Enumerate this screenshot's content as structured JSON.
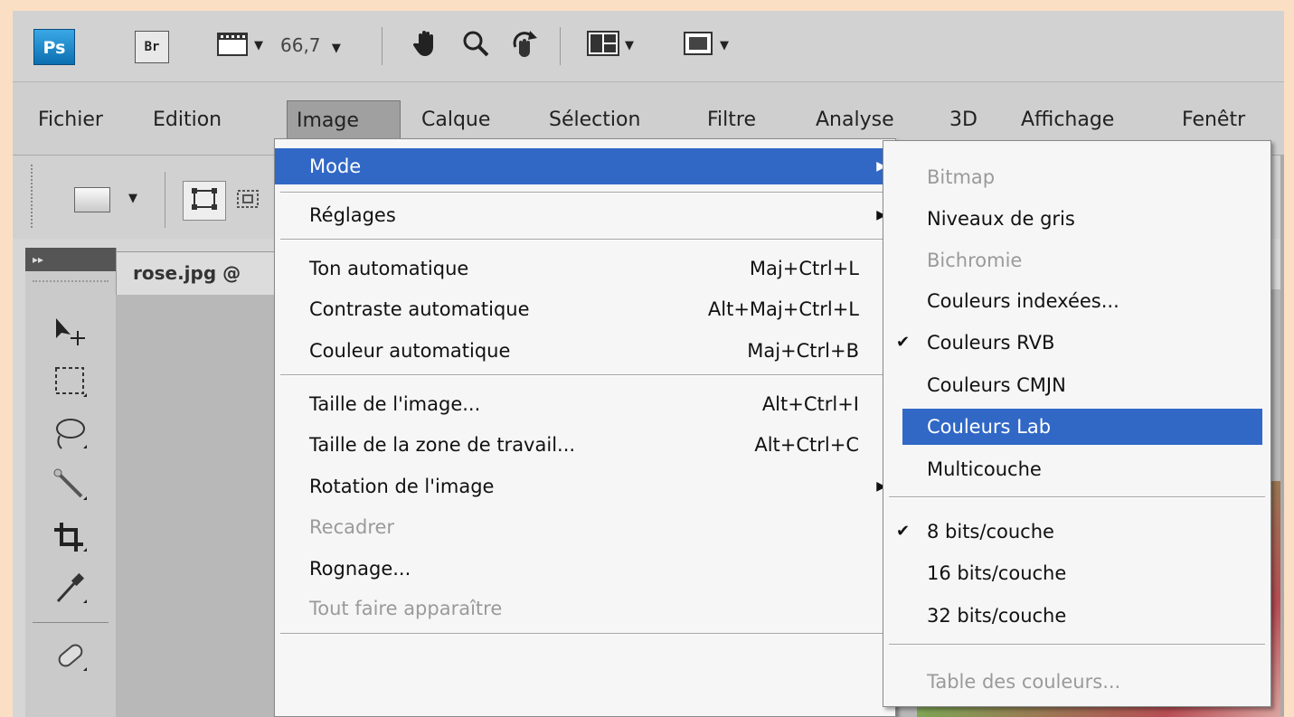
{
  "colors": {
    "highlight": "#3168c6",
    "menu_bg": "#f6f6f6",
    "disabled_text": "#9a9a9a",
    "active_menu_bg": "#a0a0a0",
    "ps_logo": "#1e8fd6"
  },
  "appbar": {
    "ps_label": "Ps",
    "br_label": "Br",
    "zoom_value": "66,7",
    "icons": [
      "film-strip-icon",
      "hand-icon",
      "zoom-icon",
      "rotate-view-icon",
      "arrange-documents-icon",
      "screen-mode-icon"
    ]
  },
  "menubar": {
    "items": [
      "Fichier",
      "Edition",
      "Image",
      "Calque",
      "Sélection",
      "Filtre",
      "Analyse",
      "3D",
      "Affichage",
      "Fenêtr"
    ],
    "active": "Image"
  },
  "document": {
    "tab_label": "rose.jpg @"
  },
  "tools": [
    "move-tool-icon",
    "marquee-tool-icon",
    "lasso-tool-icon",
    "magic-wand-tool-icon",
    "crop-tool-icon",
    "eyedropper-tool-icon",
    "healing-brush-tool-icon"
  ],
  "image_menu": {
    "items": [
      {
        "label": "Mode",
        "shortcut": "",
        "submenu": true,
        "highlighted": true,
        "disabled": false
      },
      {
        "label": "Réglages",
        "shortcut": "",
        "submenu": true,
        "highlighted": false,
        "disabled": false
      },
      {
        "label": "Ton automatique",
        "shortcut": "Maj+Ctrl+L",
        "submenu": false,
        "highlighted": false,
        "disabled": false
      },
      {
        "label": "Contraste automatique",
        "shortcut": "Alt+Maj+Ctrl+L",
        "submenu": false,
        "highlighted": false,
        "disabled": false
      },
      {
        "label": "Couleur automatique",
        "shortcut": "Maj+Ctrl+B",
        "submenu": false,
        "highlighted": false,
        "disabled": false
      },
      {
        "label": "Taille de l'image...",
        "shortcut": "Alt+Ctrl+I",
        "submenu": false,
        "highlighted": false,
        "disabled": false
      },
      {
        "label": "Taille de la zone de travail...",
        "shortcut": "Alt+Ctrl+C",
        "submenu": false,
        "highlighted": false,
        "disabled": false
      },
      {
        "label": "Rotation de l'image",
        "shortcut": "",
        "submenu": true,
        "highlighted": false,
        "disabled": false
      },
      {
        "label": "Recadrer",
        "shortcut": "",
        "submenu": false,
        "highlighted": false,
        "disabled": true
      },
      {
        "label": "Rognage...",
        "shortcut": "",
        "submenu": false,
        "highlighted": false,
        "disabled": false
      },
      {
        "label": "Tout faire apparaître",
        "shortcut": "",
        "submenu": false,
        "highlighted": false,
        "disabled": true
      }
    ]
  },
  "mode_submenu": {
    "items": [
      {
        "label": "Bitmap",
        "checked": false,
        "highlighted": false,
        "disabled": true
      },
      {
        "label": "Niveaux de gris",
        "checked": false,
        "highlighted": false,
        "disabled": false
      },
      {
        "label": "Bichromie",
        "checked": false,
        "highlighted": false,
        "disabled": true
      },
      {
        "label": "Couleurs indexées...",
        "checked": false,
        "highlighted": false,
        "disabled": false
      },
      {
        "label": "Couleurs RVB",
        "checked": true,
        "highlighted": false,
        "disabled": false
      },
      {
        "label": "Couleurs CMJN",
        "checked": false,
        "highlighted": false,
        "disabled": false
      },
      {
        "label": "Couleurs Lab",
        "checked": false,
        "highlighted": true,
        "disabled": false
      },
      {
        "label": "Multicouche",
        "checked": false,
        "highlighted": false,
        "disabled": false
      },
      {
        "label": "8 bits/couche",
        "checked": true,
        "highlighted": false,
        "disabled": false
      },
      {
        "label": "16 bits/couche",
        "checked": false,
        "highlighted": false,
        "disabled": false
      },
      {
        "label": "32 bits/couche",
        "checked": false,
        "highlighted": false,
        "disabled": false
      },
      {
        "label": "Table des couleurs...",
        "checked": false,
        "highlighted": false,
        "disabled": true
      }
    ]
  }
}
